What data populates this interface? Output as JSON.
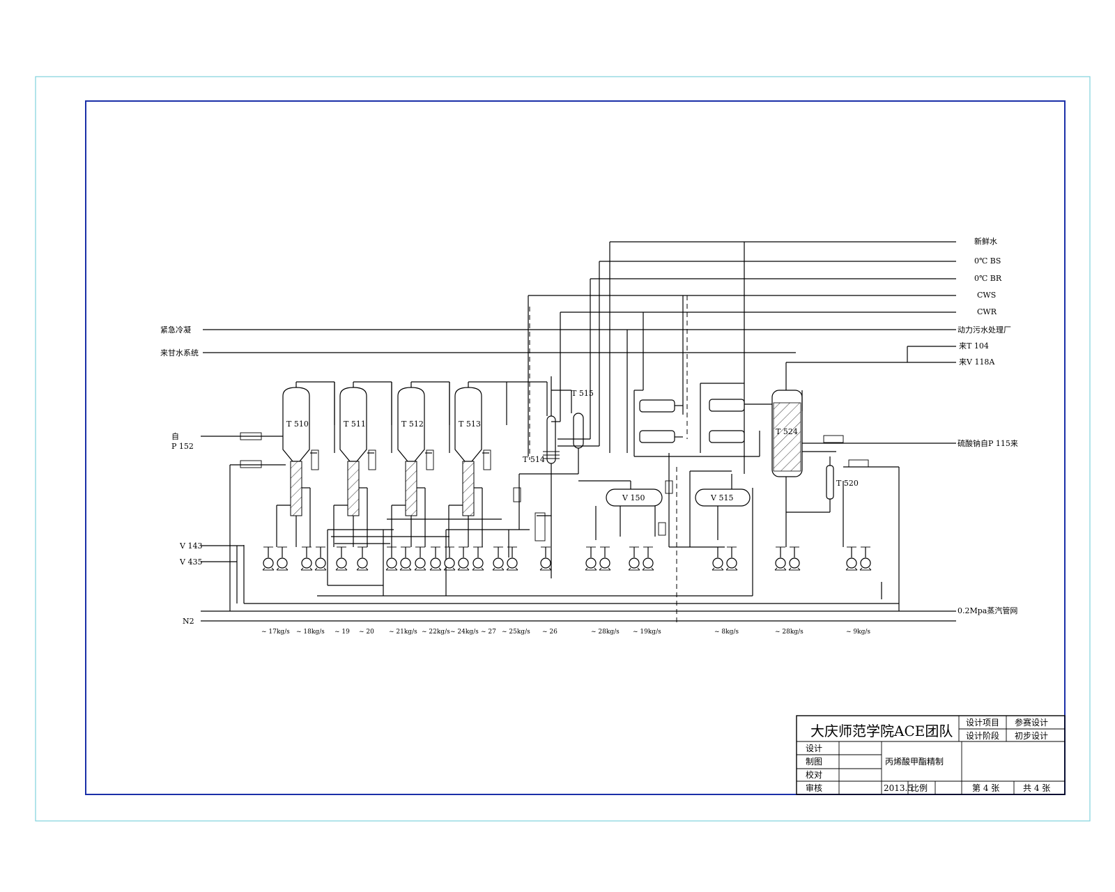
{
  "equipment": {
    "t510": "T 510",
    "t511": "T 511",
    "t512": "T 512",
    "t513": "T 513",
    "t514": "T 514",
    "t515": "T 515",
    "t520": "T 520",
    "t524": "T 524",
    "v150": "V 150",
    "v515": "V 515"
  },
  "right_streams": [
    "新鲜水",
    "0℃ BS",
    "0℃ BR",
    "CWS",
    "CWR",
    "动力污水处理厂",
    "来T 104",
    "来V 118A",
    "硫酸钠自P 115来",
    "0.2Mpa蒸汽管网"
  ],
  "left_streams": {
    "emergency": "紧急冷凝",
    "recycle": "来甘水系统",
    "from_p152_a": "自",
    "from_p152_b": "P 152",
    "v143": "V 143",
    "v435": "V 435",
    "n2": "N2"
  },
  "flow_labels": [
    "~ 17kg/s",
    "~ 18kg/s",
    "~ 19",
    "~ 20",
    "~ 21kg/s",
    "~ 22kg/s",
    "~ 24kg/s",
    "~ 27",
    "~ 25kg/s",
    "~ 26",
    "~ 28kg/s",
    "~ 19kg/s",
    "~ 8kg/s",
    "~ 28kg/s",
    "~ 9kg/s"
  ],
  "title_block": {
    "organization": "大庆师范学院ACE团队",
    "project_label": "设计项目",
    "project_value": "参赛设计",
    "stage_label": "设计阶段",
    "stage_value": "初步设计",
    "design": "设计",
    "draw": "制图",
    "check": "校对",
    "review": "审核",
    "drawing_title": "丙烯酸甲酯精制",
    "date": "2013.5",
    "scale_label": "比例",
    "sheet": "第 4 张",
    "total": "共 4 张"
  }
}
